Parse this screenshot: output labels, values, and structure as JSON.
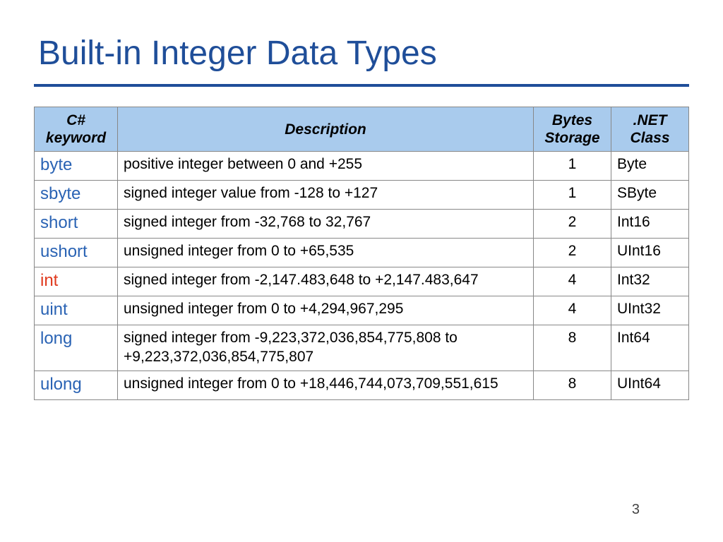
{
  "title": "Built-in Integer Data Types",
  "page_number": "3",
  "headers": {
    "keyword": "C# keyword",
    "description": "Description",
    "bytes": "Bytes Storage",
    "class": ".NET Class"
  },
  "rows": [
    {
      "keyword": "byte",
      "highlight": false,
      "description": "positive integer between 0 and +255",
      "bytes": "1",
      "class": "Byte"
    },
    {
      "keyword": "sbyte",
      "highlight": false,
      "description": "signed integer value from -128 to +127",
      "bytes": "1",
      "class": "SByte"
    },
    {
      "keyword": "short",
      "highlight": false,
      "description": "signed integer from -32,768 to 32,767",
      "bytes": "2",
      "class": "Int16"
    },
    {
      "keyword": "ushort",
      "highlight": false,
      "description": "unsigned integer from 0 to +65,535",
      "bytes": "2",
      "class": "UInt16"
    },
    {
      "keyword": "int",
      "highlight": true,
      "description": "signed integer from -2,147.483,648 to +2,147.483,647",
      "bytes": "4",
      "class": "Int32"
    },
    {
      "keyword": "uint",
      "highlight": false,
      "description": "unsigned integer from 0 to +4,294,967,295",
      "bytes": "4",
      "class": "UInt32"
    },
    {
      "keyword": "long",
      "highlight": false,
      "description": "signed integer from -9,223,372,036,854,775,808 to +9,223,372,036,854,775,807",
      "bytes": "8",
      "class": "Int64"
    },
    {
      "keyword": "ulong",
      "highlight": false,
      "description": "unsigned integer from 0 to +18,446,744,073,709,551,615",
      "bytes": "8",
      "class": "UInt64"
    }
  ]
}
